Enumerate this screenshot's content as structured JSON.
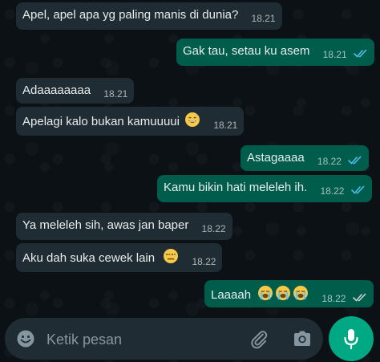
{
  "messages": [
    {
      "dir": "in",
      "text": "Apel, apel apa yg paling manis di dunia?",
      "time": "18.21"
    },
    {
      "dir": "out",
      "text": "Gak tau, setau ku asem",
      "time": "18.21",
      "status": "read"
    },
    {
      "dir": "in",
      "text": "Adaaaaaaaa",
      "time": "18.21"
    },
    {
      "dir": "in",
      "text": "Apelagi kalo bukan kamuuuui",
      "time": "18.21",
      "emoji": "smiling-sweat-emoji"
    },
    {
      "dir": "out",
      "text": "Astagaaaa",
      "time": "18.22",
      "status": "read"
    },
    {
      "dir": "out",
      "text": "Kamu bikin hati meleleh ih.",
      "time": "18.22",
      "status": "read"
    },
    {
      "dir": "in",
      "text": "Ya meleleh sih, awas jan baper",
      "time": "18.22"
    },
    {
      "dir": "in",
      "text": "Aku dah suka cewek lain",
      "time": "18.22",
      "emoji": "unamused-emoji"
    },
    {
      "dir": "out",
      "text": "Laaaah",
      "time": "18.22",
      "status": "read",
      "emoji": "loudly-crying-emoji-x3"
    }
  ],
  "composer": {
    "placeholder": "Ketik pesan",
    "icons": [
      "emoji-icon",
      "attach-icon",
      "camera-icon",
      "mic-icon"
    ]
  },
  "colors": {
    "background": "#0b1115",
    "incoming_bubble": "#1f2c33",
    "outgoing_bubble": "#005c4b",
    "read_ticks": "#53bdeb",
    "accent": "#00a884"
  }
}
